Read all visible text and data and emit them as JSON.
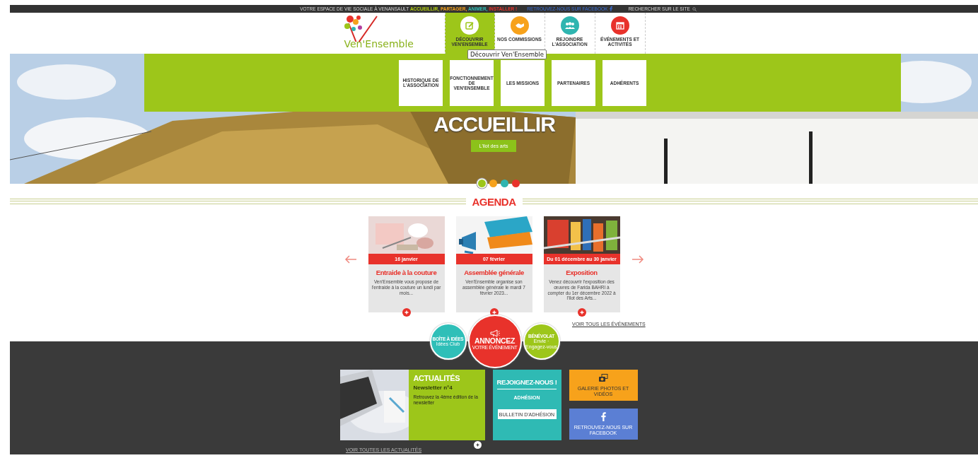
{
  "top_bar": {
    "tagline": "VOTRE ESPACE DE VIE SOCIALE À VENANSAULT",
    "tagline_words": [
      {
        "text": "ACCUEILLIR,",
        "color": "#b5d10f"
      },
      {
        "text": "PARTAGER,",
        "color": "#f7a21b"
      },
      {
        "text": "ANIMER,",
        "color": "#2fbfb8"
      },
      {
        "text": "INSTALLER !",
        "color": "#e8322b"
      }
    ],
    "facebook_link": "RETROUVEZ-NOUS SUR FACEBOOK",
    "search_label": "RECHERCHER SUR LE SITE"
  },
  "logo": {
    "text": "Ven'Ensemble"
  },
  "nav": {
    "items": [
      {
        "label": "DÉCOUVRIR VEN'ENSEMBLE",
        "selected": true,
        "color": "#9dc61a",
        "kind": "edit"
      },
      {
        "label": "NOS COMMISSIONS",
        "selected": false,
        "color": "#f7a21b",
        "kind": "handshake"
      },
      {
        "label": "REJOINDRE L'ASSOCIATION",
        "selected": false,
        "color": "#2fb5b0",
        "kind": "people"
      },
      {
        "label": "ÉVÉNEMENTS ET ACTIVITÉS",
        "selected": false,
        "color": "#e8322b",
        "kind": "calendar"
      }
    ]
  },
  "tooltip": "Découvrir Ven'Ensemble",
  "submenu": [
    "HISTORIQUE DE L'ASSOCIATION",
    "FONCTIONNEMENT DE VEN'ENSEMBLE",
    "LES MISSIONS",
    "PARTENAIRES",
    "ADHÉRENTS"
  ],
  "hero": {
    "kind": "picture",
    "title": "ACCUEILLIR",
    "button": "L'ilot des arts"
  },
  "slider_dots": [
    {
      "color": "#9dc61a",
      "selected": true
    },
    {
      "color": "#f7a21b",
      "selected": false
    },
    {
      "color": "#2fb5b0",
      "selected": false
    },
    {
      "color": "#e8322b",
      "selected": false
    }
  ],
  "agenda": {
    "title": "AGENDA",
    "events": [
      {
        "date": "16 janvier",
        "title": "Entraide à la couture",
        "excerpt": "Ven'Ensemble vous propose de l'entraide à la couture un lundi par mois..."
      },
      {
        "date": "07 février",
        "title": "Assemblée générale",
        "excerpt": "Ven'Ensemble organise son assemblée générale le mardi 7 février 2023..."
      },
      {
        "date": "Du 01 décembre au 30 janvier",
        "title": "Exposition",
        "excerpt": "Venez découvrir l'exposition des œuvres de Farida BAHRI à compter du 1er décembre 2022 à l'Ilot des Arts..."
      }
    ],
    "see_all": "VOIR TOUS LES ÉVÉNEMENTS"
  },
  "actions": [
    {
      "title": "BOÎTE À IDÉES",
      "subtitle": "Idées Club",
      "color": "#2fbfb8",
      "kind": "small"
    },
    {
      "title": "ANNONCEZ",
      "subtitle": "VOTRE ÉVÉNEMENT",
      "color": "#e8322b",
      "kind": "large"
    },
    {
      "title": "BÉNÉVOLAT",
      "subtitle": "Envie · Engagez-vous",
      "color": "#9dc61a",
      "kind": "small"
    }
  ],
  "news": {
    "heading": "ACTUALITÉS",
    "title": "Newsletter n°4",
    "excerpt": "Retrouvez la 4ème édition de la newsletter",
    "see_all": "VOIR TOUTES LES ACTUALITÉS"
  },
  "join": {
    "title": "REJOIGNEZ-NOUS !",
    "subtitle": "ADHÉSION",
    "button": "BULLETIN D'ADHÉSION"
  },
  "tiles": [
    {
      "label": "GALERIE PHOTOS ET VIDÉOS",
      "color": "#f7a21b",
      "kind": "camera"
    },
    {
      "label": "RETROUVEZ-NOUS SUR FACEBOOK",
      "color": "#5b7fd4",
      "kind": "facebook"
    }
  ]
}
